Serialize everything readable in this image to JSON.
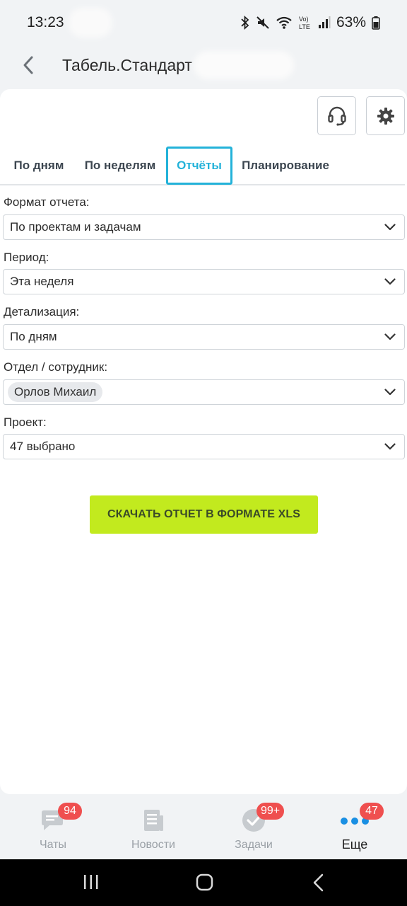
{
  "status_bar": {
    "time": "13:23",
    "battery": "63%",
    "icons": [
      "bluetooth-icon",
      "mute-icon",
      "wifi-icon",
      "volte-icon",
      "signal-icon",
      "battery-icon"
    ]
  },
  "header": {
    "title": "Табель.Стандарт"
  },
  "toolbar": {
    "icons": [
      "headset-icon",
      "gear-icon"
    ]
  },
  "tabs": [
    {
      "label": "По дням",
      "active": false
    },
    {
      "label": "По неделям",
      "active": false
    },
    {
      "label": "Отчёты",
      "active": true
    },
    {
      "label": "Планирование",
      "active": false
    }
  ],
  "form": {
    "format": {
      "label": "Формат отчета:",
      "value": "По проектам и задачам"
    },
    "period": {
      "label": "Период:",
      "value": "Эта неделя"
    },
    "detail": {
      "label": "Детализация:",
      "value": "По дням"
    },
    "department": {
      "label": "Отдел / сотрудник:",
      "value": "Орлов Михаил"
    },
    "project": {
      "label": "Проект:",
      "value": "47 выбрано"
    }
  },
  "download_button": "СКАЧАТЬ ОТЧЕТ В ФОРМАТЕ XLS",
  "bottom_nav": [
    {
      "label": "Чаты",
      "badge": "94",
      "icon": "chat-icon",
      "active": false
    },
    {
      "label": "Новости",
      "badge": "",
      "icon": "news-icon",
      "active": false
    },
    {
      "label": "Задачи",
      "badge": "99+",
      "icon": "tasks-check-icon",
      "active": false
    },
    {
      "label": "Еще",
      "badge": "47",
      "icon": "more-dots-icon",
      "active": true
    }
  ],
  "colors": {
    "accent": "#23b2d9",
    "download_button": "#c2ea1e",
    "badge": "#ef4f4f",
    "nav_active_dots": "#1a8fe3"
  }
}
